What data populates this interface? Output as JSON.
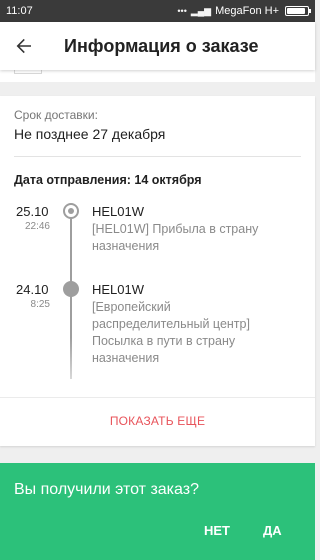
{
  "status_bar": {
    "time": "11:07",
    "carrier": "MegaFon H+",
    "icons": [
      "notification-dots-icon",
      "signal-icon"
    ],
    "battery_level": 0.9
  },
  "header": {
    "title": "Информация о заказе",
    "back_icon": "arrow-back-icon"
  },
  "delivery": {
    "label": "Срок доставки:",
    "value": "Не позднее 27 декабря"
  },
  "shipment": {
    "date_label": "Дата отправления: 14 октября"
  },
  "events": [
    {
      "date": "25.10",
      "time": "22:46",
      "title": "HEL01W",
      "description": "[HEL01W] Прибыла в страну назначения",
      "marker": "current"
    },
    {
      "date": "24.10",
      "time": "8:25",
      "title": "HEL01W",
      "description": "[Европейский распределительный центр] Посылка в пути в страну назначения",
      "marker": "past"
    }
  ],
  "show_more_label": "ПОКАЗАТЬ ЕЩЕ",
  "confirm_prompt": {
    "question": "Вы получили этот заказ?",
    "no_label": "НЕТ",
    "yes_label": "ДА"
  },
  "colors": {
    "accent_green": "#2cc17a",
    "link_red": "#e8535a",
    "timeline_gray": "#9e9e9e"
  }
}
